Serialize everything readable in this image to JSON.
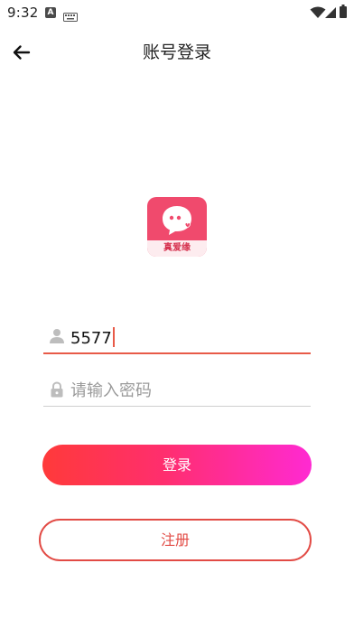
{
  "status_bar": {
    "time": "9:32",
    "a_badge": "A",
    "icons": [
      "notification-a-icon",
      "keyboard-icon",
      "wifi-icon",
      "signal-icon",
      "battery-icon"
    ]
  },
  "header": {
    "title": "账号登录",
    "back_icon": "arrow-left-icon"
  },
  "logo": {
    "text": "真爱缘",
    "colors": {
      "background": "#f04a6d",
      "banner": "#fdecef",
      "text": "#d6324f"
    }
  },
  "form": {
    "username": {
      "value": "5577",
      "icon": "person-icon"
    },
    "password": {
      "placeholder": "请输入密码",
      "icon": "lock-icon"
    }
  },
  "buttons": {
    "login_label": "登录",
    "register_label": "注册"
  },
  "colors": {
    "accent": "#e85a48",
    "login_gradient_start": "#ff3a3a",
    "login_gradient_end": "#ff2ad2",
    "register_border": "#e24b45"
  }
}
